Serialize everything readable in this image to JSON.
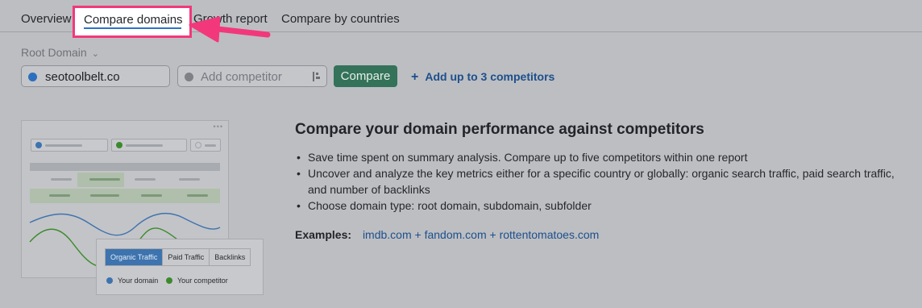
{
  "tabs": [
    {
      "label": "Overview"
    },
    {
      "label": "Compare domains"
    },
    {
      "label": "Growth report"
    },
    {
      "label": "Compare by countries"
    }
  ],
  "root_domain": {
    "label": "Root Domain"
  },
  "domain_input": {
    "value": "seotoolbelt.co"
  },
  "competitor_input": {
    "placeholder": "Add competitor"
  },
  "compare_button": {
    "label": "Compare"
  },
  "add_link": {
    "label": "Add up to 3 competitors"
  },
  "promo": {
    "headline": "Compare your domain performance against competitors",
    "bullets": [
      "Save time spent on summary analysis. Compare up to five competitors within one report",
      "Uncover and analyze the key metrics either for a specific country or globally: organic search traffic, paid search traffic, and number of backlinks",
      "Choose domain type: root domain, subdomain, subfolder"
    ],
    "examples_label": "Examples:",
    "examples_link": "imdb.com + fandom.com + rottentomatoes.com"
  },
  "illustration": {
    "tabs": [
      "Organic Traffic",
      "Paid Traffic",
      "Backlinks"
    ],
    "legend": [
      "Your domain",
      "Your competitor"
    ]
  },
  "colors": {
    "accent": "#f2387b",
    "compare_button": "#347259",
    "link": "#1d4f8c",
    "your_domain": "#2d6fbd",
    "competitor": "#3c8a2c"
  }
}
